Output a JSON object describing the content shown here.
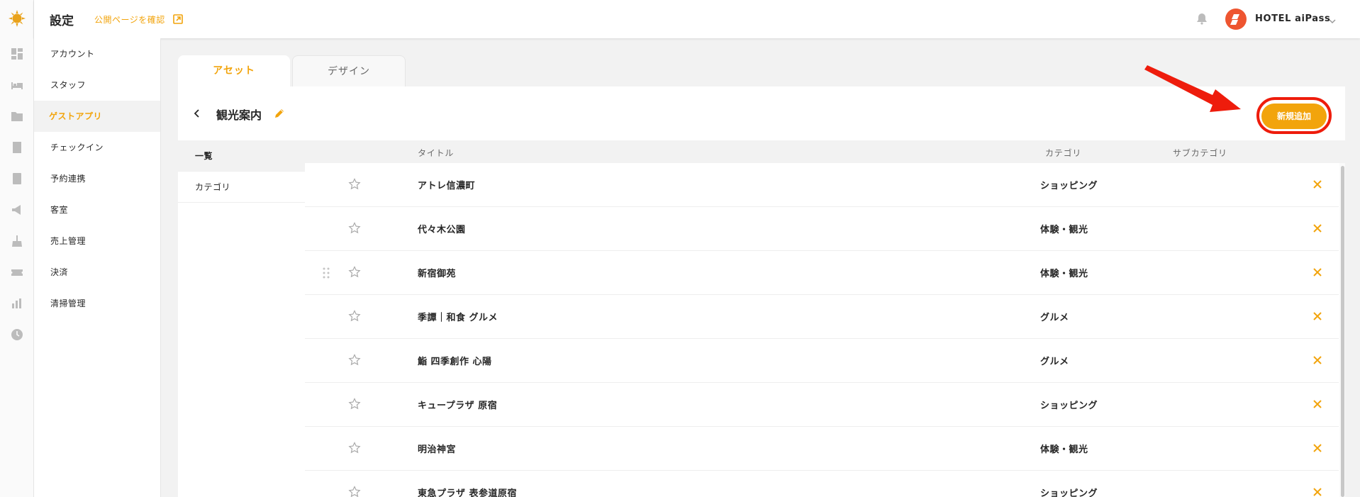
{
  "colors": {
    "accent": "#f2a40c",
    "annotation_red": "#ee1c0c",
    "delete_x": "#f2a40c",
    "avatar": "#ee5530"
  },
  "header": {
    "title": "設定",
    "public_link": "公開ページを確認",
    "hotel_name": "HOTEL aiPass"
  },
  "rail": {
    "icons": [
      "dashboard-icon",
      "bed-icon",
      "guest-card-icon",
      "building-icon",
      "calculator-icon",
      "megaphone-icon",
      "cleaning-icon",
      "ticket-icon",
      "bar-chart-icon",
      "clock-icon"
    ]
  },
  "menu": {
    "items": [
      {
        "label": "アカウント"
      },
      {
        "label": "スタッフ"
      },
      {
        "label": "ゲストアプリ",
        "active": true
      },
      {
        "label": "チェックイン"
      },
      {
        "label": "予約連携"
      },
      {
        "label": "客室"
      },
      {
        "label": "売上管理"
      },
      {
        "label": "決済"
      },
      {
        "label": "清掃管理"
      }
    ]
  },
  "tabs": [
    {
      "label": "アセット",
      "active": true
    },
    {
      "label": "デザイン",
      "active": false
    }
  ],
  "page": {
    "title": "観光案内",
    "add_button": "新規追加"
  },
  "subnav": {
    "items": [
      {
        "label": "一覧",
        "active": true
      },
      {
        "label": "カテゴリ",
        "active": false
      }
    ]
  },
  "table": {
    "columns": {
      "title": "タイトル",
      "category": "カテゴリ",
      "subcategory": "サブカテゴリ"
    },
    "rows": [
      {
        "title": "アトレ信濃町",
        "category": "ショッピング",
        "subcategory": ""
      },
      {
        "title": "代々木公園",
        "category": "体験・観光",
        "subcategory": ""
      },
      {
        "title": "新宿御苑",
        "category": "体験・観光",
        "subcategory": ""
      },
      {
        "title": "季譚｜和食 グルメ",
        "category": "グルメ",
        "subcategory": ""
      },
      {
        "title": "鮨 四季創作 心陽",
        "category": "グルメ",
        "subcategory": ""
      },
      {
        "title": "キュープラザ 原宿",
        "category": "ショッピング",
        "subcategory": ""
      },
      {
        "title": "明治神宮",
        "category": "体験・観光",
        "subcategory": ""
      },
      {
        "title": "東急プラザ 表参道原宿",
        "category": "ショッピング",
        "subcategory": ""
      }
    ]
  }
}
